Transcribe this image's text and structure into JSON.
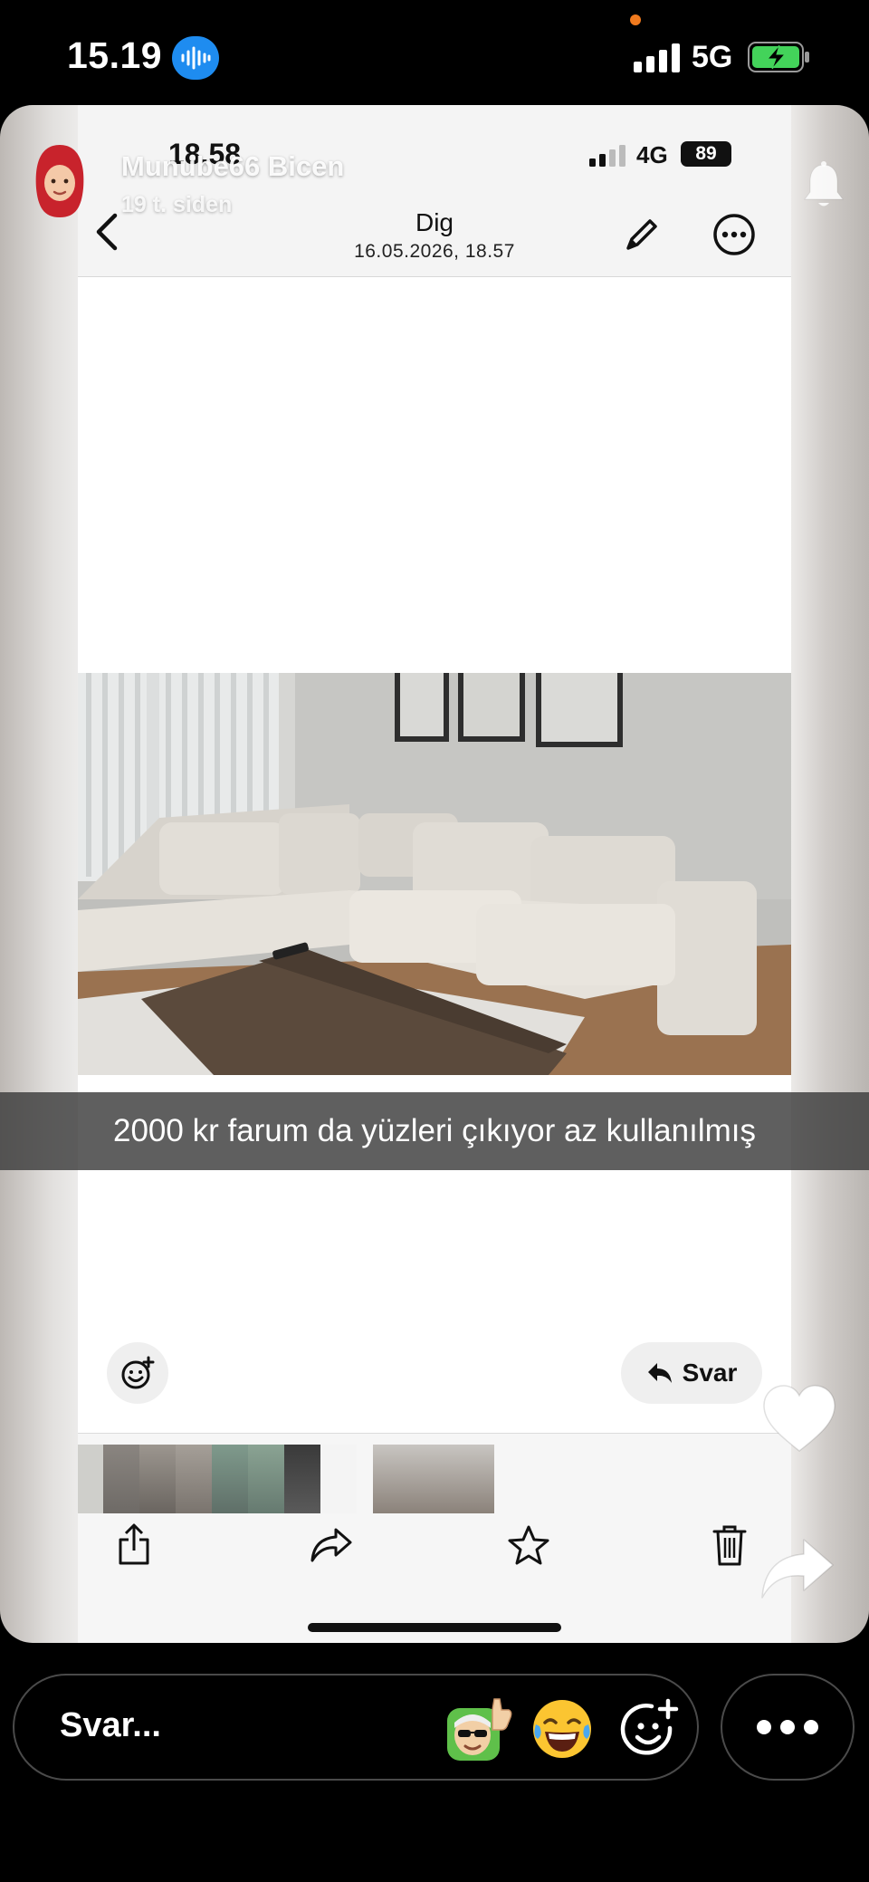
{
  "status_bar": {
    "time": "15.19",
    "network": "5G"
  },
  "story": {
    "username": "Munube66 Bicen",
    "age": "19 t. siden",
    "caption": "2000 kr farum da yüzleri çıkıyor az kullanılmış"
  },
  "inner_screenshot": {
    "time": "18.58",
    "network": "4G",
    "battery": "89",
    "title": "Dig",
    "date": "16.05.2026, 18.57",
    "reply_label": "Svar"
  },
  "reply_bar": {
    "placeholder": "Svar..."
  }
}
